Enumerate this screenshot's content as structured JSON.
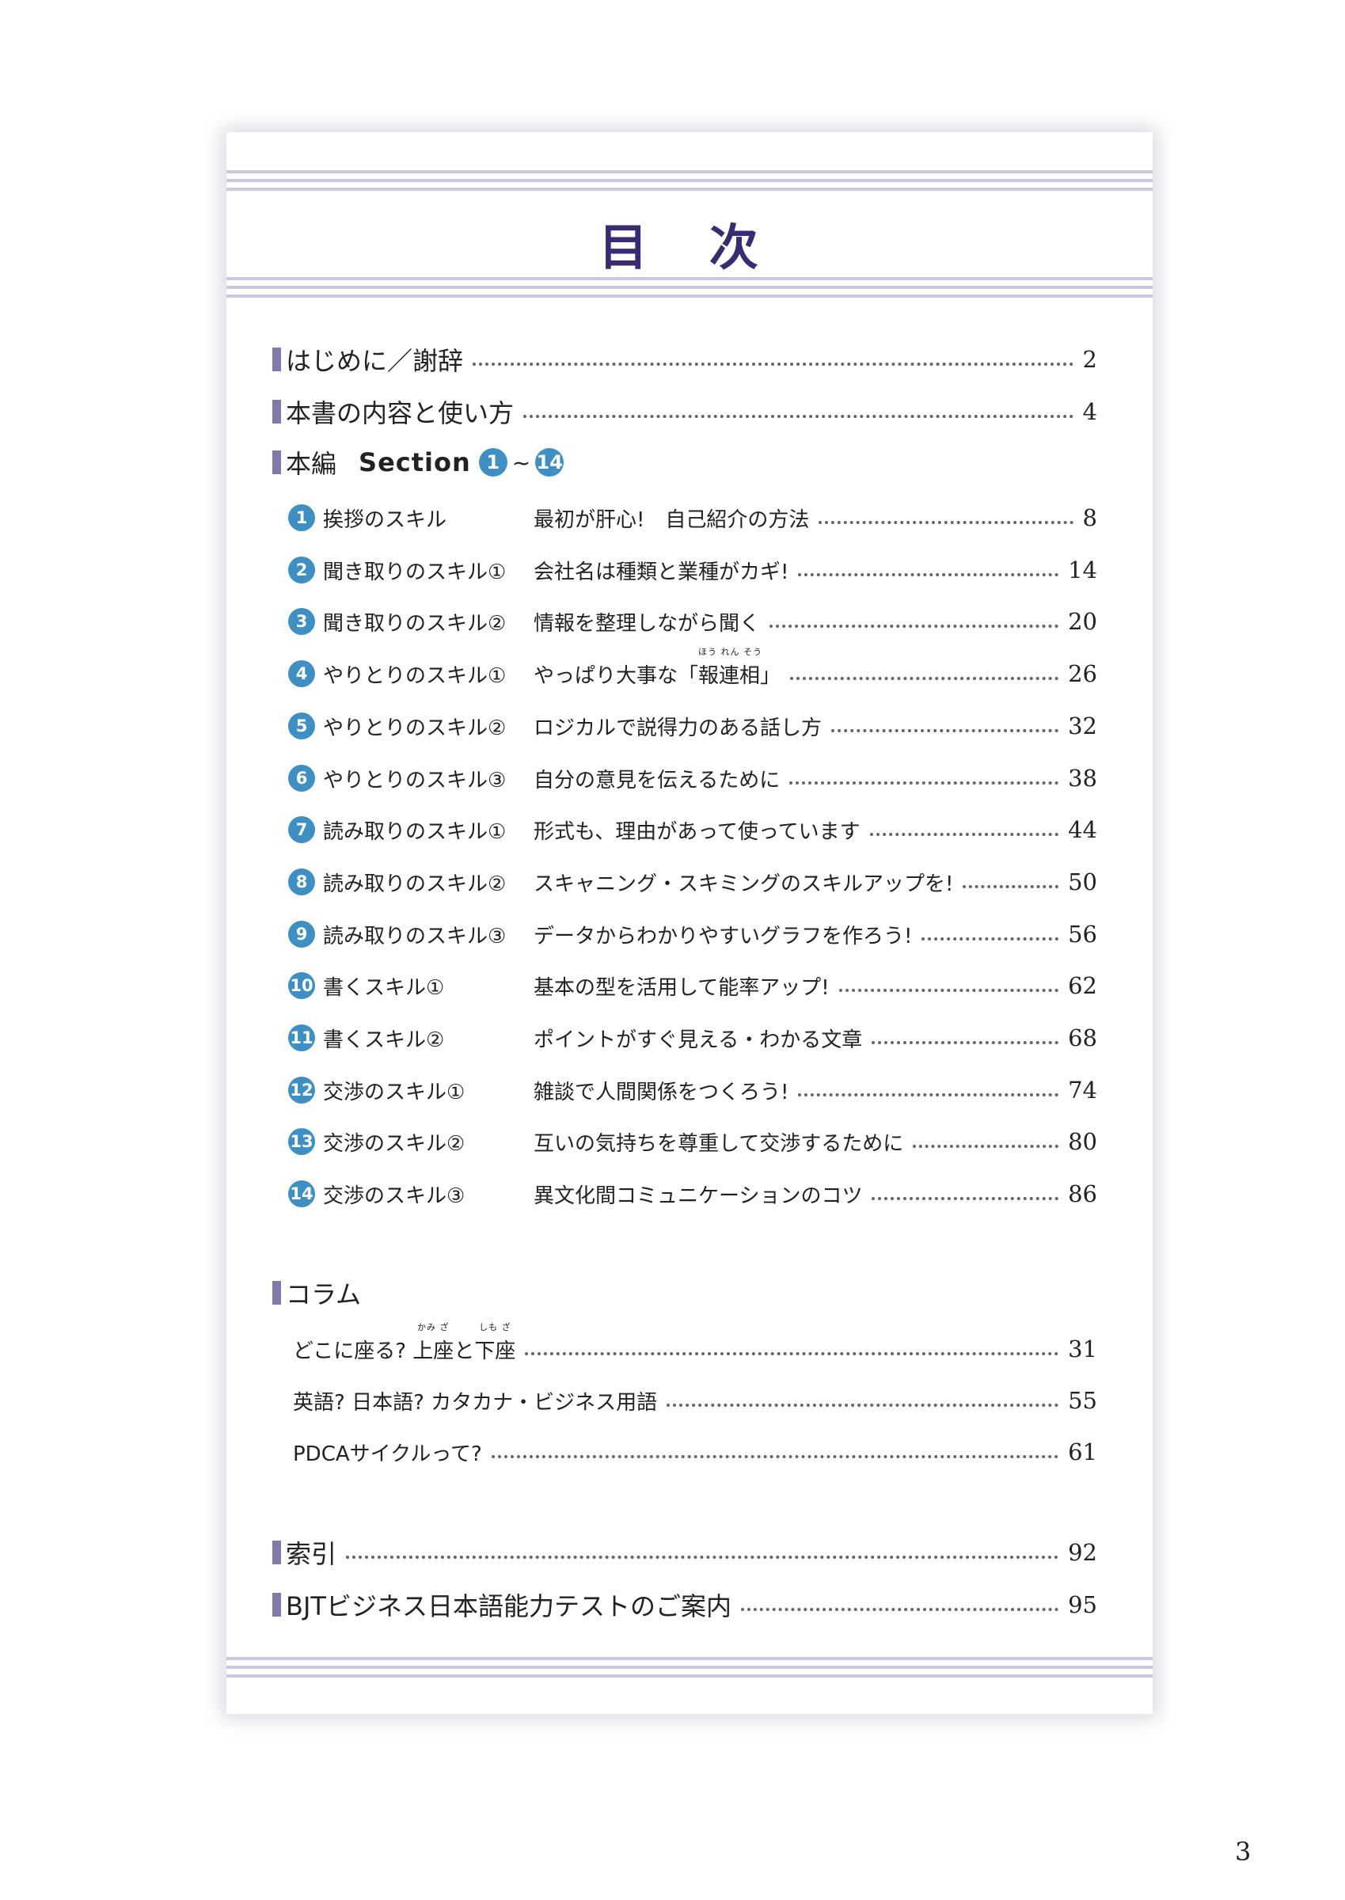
{
  "title": "目 次",
  "main_entries": [
    {
      "label": "はじめに／謝辞",
      "page": "2"
    },
    {
      "label": "本書の内容と使い方",
      "page": "4"
    }
  ],
  "section_heading": {
    "label": "本編",
    "section": "Section",
    "from": "1",
    "tilde": "~",
    "to": "14"
  },
  "sections": [
    {
      "num": "1",
      "skill": "挨拶のスキル",
      "desc": "最初が肝心!　自己紹介の方法",
      "page": "8"
    },
    {
      "num": "2",
      "skill": "聞き取りのスキル①",
      "desc": "会社名は種類と業種がカギ!",
      "page": "14"
    },
    {
      "num": "3",
      "skill": "聞き取りのスキル②",
      "desc": "情報を整理しながら聞く",
      "page": "20"
    },
    {
      "num": "4",
      "skill": "やりとりのスキル①",
      "desc_pre": "やっぱり大事な「",
      "desc_word": "報連相",
      "desc_ruby": "ほう れん そう",
      "desc_post": "」",
      "page": "26"
    },
    {
      "num": "5",
      "skill": "やりとりのスキル②",
      "desc": "ロジカルで説得力のある話し方",
      "page": "32"
    },
    {
      "num": "6",
      "skill": "やりとりのスキル③",
      "desc": "自分の意見を伝えるために",
      "page": "38"
    },
    {
      "num": "7",
      "skill": "読み取りのスキル①",
      "desc": "形式も、理由があって使っています",
      "page": "44"
    },
    {
      "num": "8",
      "skill": "読み取りのスキル②",
      "desc": "スキャニング・スキミングのスキルアップを!",
      "page": "50"
    },
    {
      "num": "9",
      "skill": "読み取りのスキル③",
      "desc": "データからわかりやすいグラフを作ろう!",
      "page": "56"
    },
    {
      "num": "10",
      "skill": "書くスキル①",
      "desc": "基本の型を活用して能率アップ!",
      "page": "62"
    },
    {
      "num": "11",
      "skill": "書くスキル②",
      "desc": "ポイントがすぐ見える・わかる文章",
      "page": "68"
    },
    {
      "num": "12",
      "skill": "交渉のスキル①",
      "desc": "雑談で人間関係をつくろう!",
      "page": "74"
    },
    {
      "num": "13",
      "skill": "交渉のスキル②",
      "desc": "互いの気持ちを尊重して交渉するために",
      "page": "80"
    },
    {
      "num": "14",
      "skill": "交渉のスキル③",
      "desc": "異文化間コミュニケーションのコツ",
      "page": "86"
    }
  ],
  "column_heading": "コラム",
  "columns": [
    {
      "pre": "どこに座る? ",
      "w1": "上座",
      "r1": "かみ ざ",
      "mid": "と",
      "w2": "下座",
      "r2": "しも ざ",
      "page": "31"
    },
    {
      "label": "英語? 日本語? カタカナ・ビジネス用語",
      "page": "55"
    },
    {
      "label": "PDCAサイクルって?",
      "page": "61"
    }
  ],
  "end_entries": [
    {
      "label": "索引",
      "page": "92"
    },
    {
      "label": "BJTビジネス日本語能力テストのご案内",
      "page": "95"
    }
  ],
  "page_number": "3"
}
